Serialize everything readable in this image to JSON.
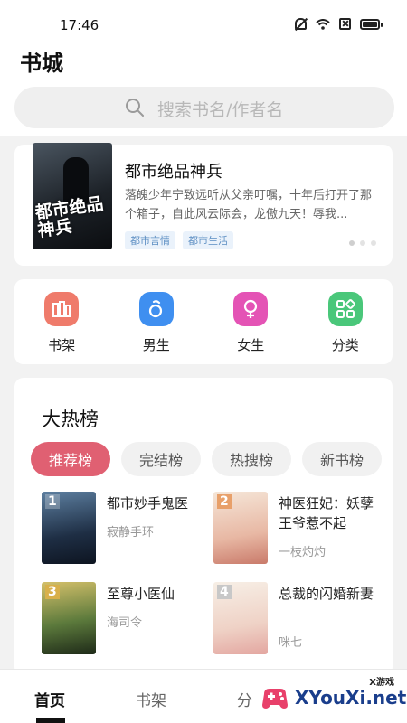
{
  "status_bar": {
    "time": "17:46"
  },
  "header": {
    "title": "书城"
  },
  "search": {
    "placeholder": "搜索书名/作者名"
  },
  "featured": {
    "cover_text": "都市绝品神兵",
    "title": "都市绝品神兵",
    "description": "落魄少年宁致远听从父亲叮嘱，十年后打开了那个箱子，自此风云际会，龙傲九天！辱我...",
    "tags": [
      "都市言情",
      "都市生活"
    ]
  },
  "quick_nav": [
    {
      "label": "书架",
      "icon": "bookshelf-icon",
      "color": "#ef7b6b"
    },
    {
      "label": "男生",
      "icon": "male-icon",
      "color": "#3f8ff0"
    },
    {
      "label": "女生",
      "icon": "female-icon",
      "color": "#e453b5"
    },
    {
      "label": "分类",
      "icon": "category-icon",
      "color": "#4ac77a"
    }
  ],
  "ranking": {
    "title": "大热榜",
    "tabs": [
      "推荐榜",
      "完结榜",
      "热搜榜",
      "新书榜"
    ],
    "active_tab": "推荐榜",
    "books": [
      {
        "rank": "1",
        "name": "都市妙手鬼医",
        "author": "寂静手环"
      },
      {
        "rank": "2",
        "name": "神医狂妃：妖孽王爷惹不起",
        "author": "一枝灼灼"
      },
      {
        "rank": "3",
        "name": "至尊小医仙",
        "author": "海司令"
      },
      {
        "rank": "4",
        "name": "总裁的闪婚新妻",
        "author": "咪七"
      }
    ]
  },
  "tabbar": {
    "items": [
      "首页",
      "书架",
      "分"
    ],
    "active": "首页"
  },
  "watermark": {
    "tag": "X游戏",
    "text": "XYouXi.net"
  },
  "colors": {
    "accent": "#e06072",
    "tag_blue": "#5b8dc2"
  }
}
